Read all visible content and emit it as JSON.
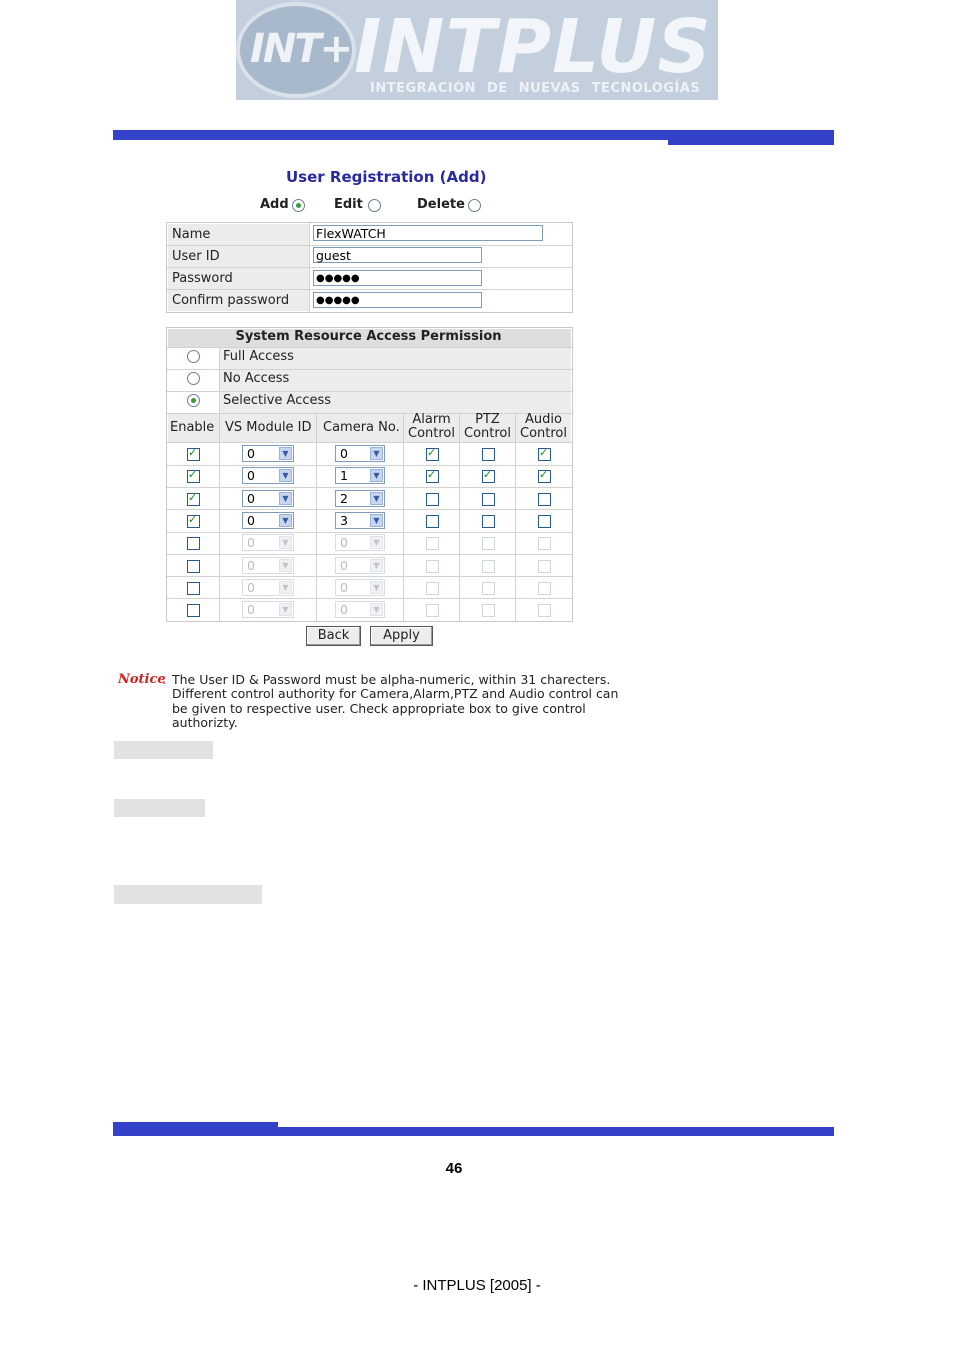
{
  "logo": {
    "emblem": "INT+",
    "brand": "INTPLUS",
    "tagline": "INTEGRACIÓN DE NUEVAS TECNOLOGÍAS"
  },
  "form": {
    "title": "User Registration (Add)",
    "modes": [
      {
        "label": "Add",
        "selected": true
      },
      {
        "label": "Edit",
        "selected": false
      },
      {
        "label": "Delete",
        "selected": false
      }
    ],
    "fields": [
      {
        "label": "Name",
        "value": "FlexWATCH"
      },
      {
        "label": "User ID",
        "value": "guest"
      },
      {
        "label": "Password",
        "value": "●●●●●"
      },
      {
        "label": "Confirm password",
        "value": "●●●●●"
      }
    ]
  },
  "permissions": {
    "title": "System Resource Access Permission",
    "options": [
      {
        "label": "Full Access",
        "selected": false
      },
      {
        "label": "No Access",
        "selected": false
      },
      {
        "label": "Selective Access",
        "selected": true
      }
    ],
    "headers": [
      "Enable",
      "VS Module ID",
      "Camera No.",
      "Alarm\nControl",
      "PTZ\nControl",
      "Audio\nControl"
    ],
    "header_alarm": [
      "Alarm",
      "Control"
    ],
    "header_ptz": [
      "PTZ",
      "Control"
    ],
    "header_audio": [
      "Audio",
      "Control"
    ],
    "rows": [
      {
        "enable": true,
        "module": "0",
        "camera": "0",
        "alarm": true,
        "ptz": false,
        "audio": true
      },
      {
        "enable": true,
        "module": "0",
        "camera": "1",
        "alarm": true,
        "ptz": true,
        "audio": true
      },
      {
        "enable": true,
        "module": "0",
        "camera": "2",
        "alarm": false,
        "ptz": false,
        "audio": false
      },
      {
        "enable": true,
        "module": "0",
        "camera": "3",
        "alarm": false,
        "ptz": false,
        "audio": false
      },
      {
        "enable": false,
        "module": "0",
        "camera": "0",
        "alarm": false,
        "ptz": false,
        "audio": false
      },
      {
        "enable": false,
        "module": "0",
        "camera": "0",
        "alarm": false,
        "ptz": false,
        "audio": false
      },
      {
        "enable": false,
        "module": "0",
        "camera": "0",
        "alarm": false,
        "ptz": false,
        "audio": false
      },
      {
        "enable": false,
        "module": "0",
        "camera": "0",
        "alarm": false,
        "ptz": false,
        "audio": false
      }
    ]
  },
  "buttons": {
    "back": "Back",
    "apply": "Apply"
  },
  "notice": {
    "label": "Notice",
    "colon": ":",
    "lines": [
      "The User ID & Password must be alpha-numeric, within 31 charecters.",
      "Different control authority for Camera,Alarm,PTZ and Audio control can",
      "be given to respective user. Check appropriate box to give control",
      "authorizty."
    ]
  },
  "footer": {
    "page_number": "46",
    "copyright": "- INTPLUS [2005] -"
  },
  "colors": {
    "bar": "#3342c8",
    "title": "#2a2aa0",
    "notice": "#cc2222"
  }
}
